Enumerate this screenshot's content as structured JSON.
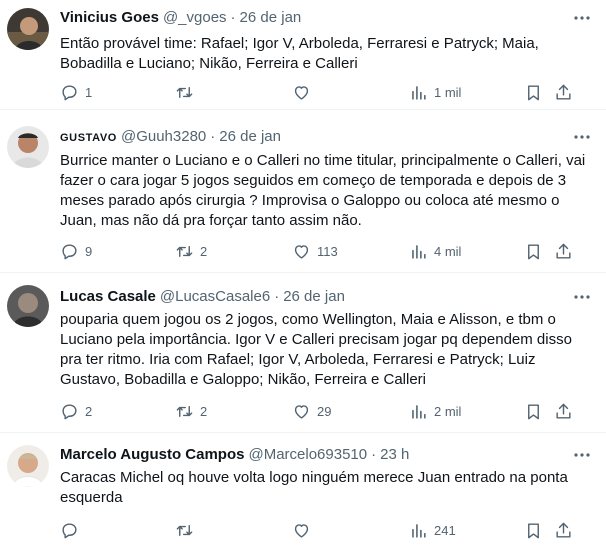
{
  "tweets": [
    {
      "name": "Vinicius Goes",
      "handle": "@_vgoes",
      "dot": "·",
      "time": "26 de jan",
      "text": "Então provável time: Rafael; Igor V, Arboleda, Ferraresi e Patryck; Maia, Bobadilla e Luciano; Nikão, Ferreira e Calleri",
      "replies": "1",
      "retweets": "",
      "likes": "",
      "views": "1 mil"
    },
    {
      "name": "GUSTAVO",
      "handle": "@Guuh3280",
      "dot": "·",
      "time": "26 de jan",
      "text": "Burrice manter o Luciano e o Calleri no time titular, principalmente o Calleri, vai fazer o cara jogar 5 jogos seguidos em começo de temporada e depois de 3 meses parado após cirurgia ? Improvisa o Galoppo ou coloca até mesmo o Juan, mas não dá pra forçar tanto assim não.",
      "replies": "9",
      "retweets": "2",
      "likes": "113",
      "views": "4 mil"
    },
    {
      "name": "Lucas Casale",
      "handle": "@LucasCasale6",
      "dot": "·",
      "time": "26 de jan",
      "text": "pouparia quem jogou os 2 jogos, como Wellington, Maia e Alisson, e tbm o Luciano pela importância. Igor V e Calleri precisam jogar pq dependem disso pra ter ritmo. Iria com Rafael; Igor V, Arboleda, Ferraresi e Patryck; Luiz Gustavo, Bobadilla e Galoppo; Nikão, Ferreira e Calleri",
      "replies": "2",
      "retweets": "2",
      "likes": "29",
      "views": "2 mil"
    },
    {
      "name": "Marcelo Augusto Campos",
      "handle": "@Marcelo693510",
      "dot": "·",
      "time": "23 h",
      "text": "Caracas Michel oq houve volta logo ninguém merece Juan entrado na ponta esquerda",
      "replies": "",
      "retweets": "",
      "likes": "",
      "views": "241"
    }
  ],
  "colors": {
    "text": "#0f1419",
    "secondary": "#536471",
    "divider": "#eff3f4"
  },
  "icons": [
    "reply-icon",
    "retweet-icon",
    "like-icon",
    "views-icon",
    "bookmark-icon",
    "share-icon",
    "more-icon"
  ]
}
